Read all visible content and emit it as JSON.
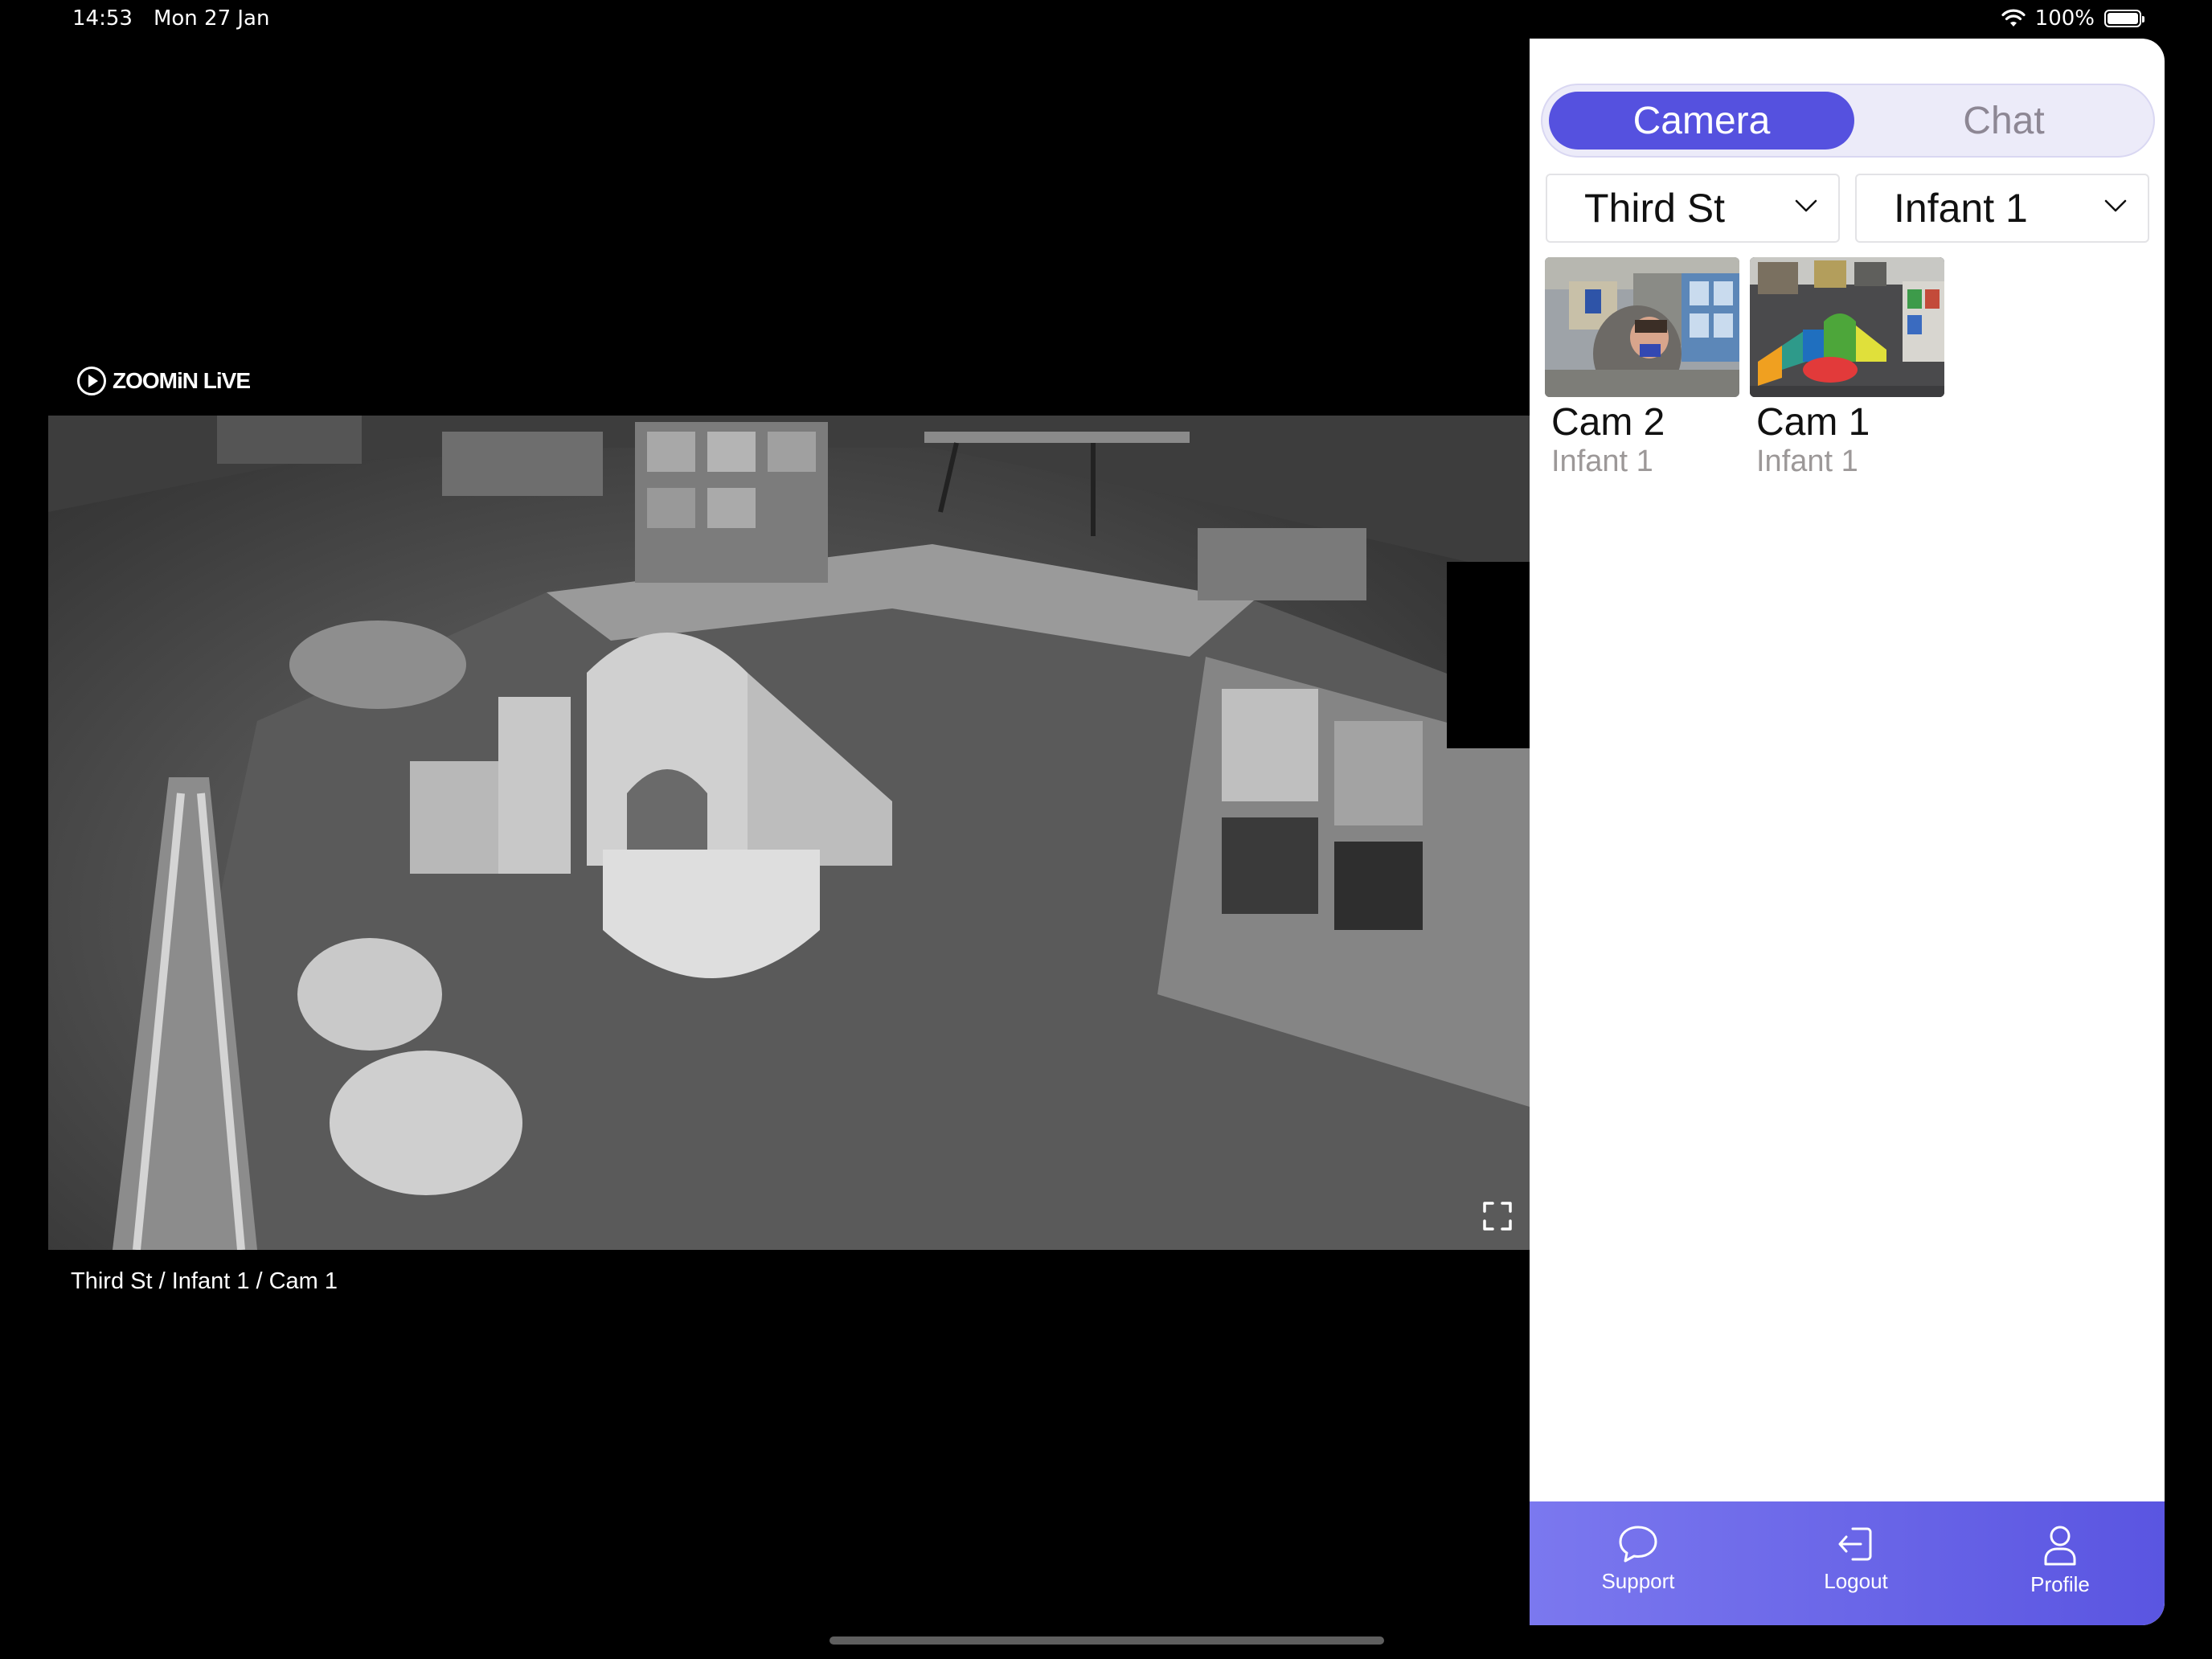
{
  "status_bar": {
    "time": "14:53",
    "date": "Mon 27 Jan",
    "battery": "100%"
  },
  "brand": {
    "name": "ZOOMiN LiVE"
  },
  "player": {
    "breadcrumb": "Third St / Infant 1 / Cam 1"
  },
  "panel": {
    "tabs": [
      {
        "label": "Camera",
        "active": true
      },
      {
        "label": "Chat",
        "active": false
      }
    ],
    "site_select": {
      "value": "Third St"
    },
    "room_select": {
      "value": "Infant 1"
    },
    "cameras": [
      {
        "name": "Cam 2",
        "room": "Infant 1"
      },
      {
        "name": "Cam 1",
        "room": "Infant 1"
      }
    ]
  },
  "bottom_nav": {
    "support": "Support",
    "logout": "Logout",
    "profile": "Profile"
  },
  "colors": {
    "accent": "#5551df",
    "nav_gradient_start": "#7b78ef",
    "nav_gradient_end": "#5a55e1",
    "muted_text": "#9c9898"
  }
}
